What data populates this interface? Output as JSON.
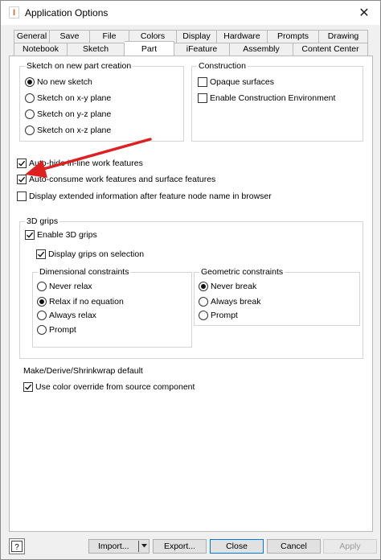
{
  "window": {
    "title": "Application Options",
    "close_glyph": "✕",
    "app_icon_letter": "I"
  },
  "tabs": {
    "row1": [
      "General",
      "Save",
      "File",
      "Colors",
      "Display",
      "Hardware",
      "Prompts",
      "Drawing"
    ],
    "row2": [
      "Notebook",
      "Sketch",
      "Part",
      "iFeature",
      "Assembly",
      "Content Center"
    ],
    "active": "Part"
  },
  "sketch_group": {
    "title": "Sketch on new part creation",
    "options": [
      {
        "label": "No new sketch",
        "selected": true
      },
      {
        "label": "Sketch on x-y plane",
        "selected": false
      },
      {
        "label": "Sketch on y-z plane",
        "selected": false
      },
      {
        "label": "Sketch on x-z plane",
        "selected": false
      }
    ]
  },
  "construction_group": {
    "title": "Construction",
    "options": [
      {
        "label": "Opaque surfaces",
        "checked": false
      },
      {
        "label": "Enable Construction Environment",
        "checked": false
      }
    ]
  },
  "work_features": [
    {
      "label": "Auto-hide in-line work features",
      "checked": true
    },
    {
      "label": "Auto-consume work features and surface features",
      "checked": true
    },
    {
      "label": "Display extended information after feature node name in browser",
      "checked": false
    }
  ],
  "grips_group": {
    "title": "3D grips",
    "enable": {
      "label": "Enable 3D grips",
      "checked": true
    },
    "display_on_selection": {
      "label": "Display grips on selection",
      "checked": true
    },
    "dimensional": {
      "title": "Dimensional constraints",
      "options": [
        {
          "label": "Never relax",
          "selected": false
        },
        {
          "label": "Relax if no equation",
          "selected": true
        },
        {
          "label": "Always relax",
          "selected": false
        },
        {
          "label": "Prompt",
          "selected": false
        }
      ]
    },
    "geometric": {
      "title": "Geometric constraints",
      "options": [
        {
          "label": "Never break",
          "selected": true
        },
        {
          "label": "Always break",
          "selected": false
        },
        {
          "label": "Prompt",
          "selected": false
        }
      ]
    }
  },
  "make_derive": {
    "title": "Make/Derive/Shrinkwrap default",
    "option": {
      "label": "Use color override from source component",
      "checked": true
    }
  },
  "buttons": {
    "help": "?",
    "import": "Import...",
    "export": "Export...",
    "close": "Close",
    "cancel": "Cancel",
    "apply": "Apply"
  },
  "annotation": {
    "arrow_color": "#e02020"
  }
}
